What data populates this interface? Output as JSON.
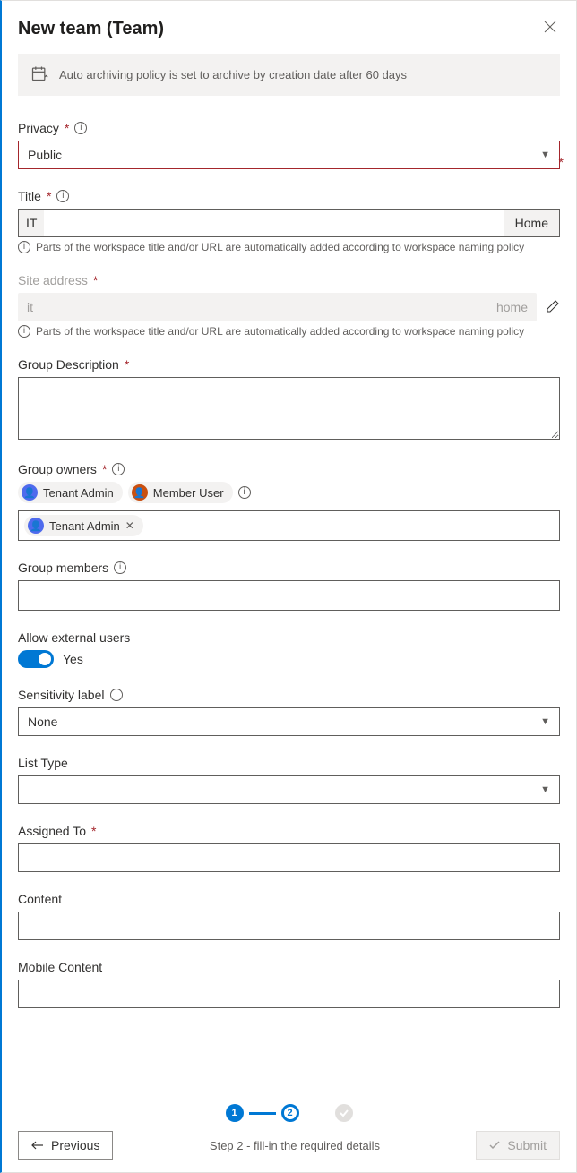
{
  "header": {
    "title": "New team (Team)"
  },
  "banner": {
    "text": "Auto archiving policy is set to archive by creation date after 60 days"
  },
  "privacy": {
    "label": "Privacy",
    "value": "Public"
  },
  "title_field": {
    "label": "Title",
    "prefix": "IT",
    "value": "",
    "suffix": "Home",
    "helper": "Parts of the workspace title and/or URL are automatically added according to workspace naming policy"
  },
  "site_address": {
    "label": "Site address",
    "prefix": "it",
    "suffix": "home",
    "helper": "Parts of the workspace title and/or URL are automatically added according to workspace naming policy"
  },
  "group_description": {
    "label": "Group Description",
    "value": ""
  },
  "group_owners": {
    "label": "Group owners",
    "suggestions": [
      "Tenant Admin",
      "Member User"
    ],
    "selected": [
      "Tenant Admin"
    ]
  },
  "group_members": {
    "label": "Group members"
  },
  "allow_external": {
    "label": "Allow external users",
    "state_text": "Yes"
  },
  "sensitivity": {
    "label": "Sensitivity label",
    "value": "None"
  },
  "list_type": {
    "label": "List Type",
    "value": ""
  },
  "assigned_to": {
    "label": "Assigned To",
    "value": ""
  },
  "content": {
    "label": "Content",
    "value": ""
  },
  "mobile_content": {
    "label": "Mobile Content",
    "value": ""
  },
  "footer": {
    "step_text": "Step 2 - fill-in the required details",
    "prev": "Previous",
    "submit": "Submit",
    "step1": "1",
    "step2": "2"
  }
}
